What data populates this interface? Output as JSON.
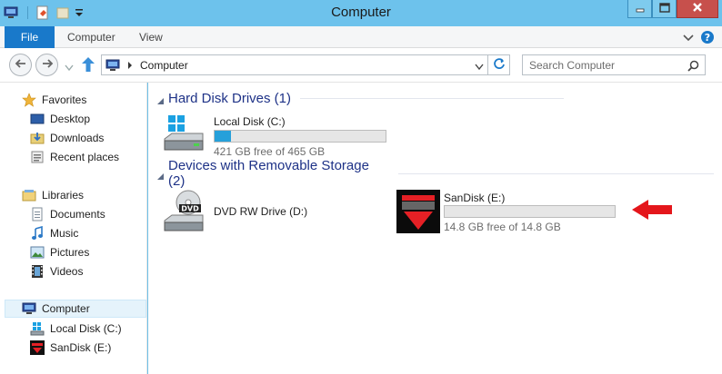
{
  "window": {
    "title": "Computer",
    "accent": "#6dc2ec"
  },
  "ribbon": {
    "tabs": [
      {
        "label": "File"
      },
      {
        "label": "Computer"
      },
      {
        "label": "View"
      }
    ]
  },
  "address": {
    "path": "Computer"
  },
  "search": {
    "placeholder": "Search Computer"
  },
  "sidebar": {
    "favorites": {
      "label": "Favorites",
      "items": [
        {
          "label": "Desktop"
        },
        {
          "label": "Downloads"
        },
        {
          "label": "Recent places"
        }
      ]
    },
    "libraries": {
      "label": "Libraries",
      "items": [
        {
          "label": "Documents"
        },
        {
          "label": "Music"
        },
        {
          "label": "Pictures"
        },
        {
          "label": "Videos"
        }
      ]
    },
    "computer": {
      "label": "Computer",
      "items": [
        {
          "label": "Local Disk (C:)"
        },
        {
          "label": "SanDisk (E:)"
        }
      ]
    }
  },
  "content": {
    "hard_disk_group": "Hard Disk Drives (1)",
    "removable_group": "Devices with Removable Storage (2)",
    "drives": {
      "local_disk": {
        "name": "Local Disk (C:)",
        "free": "421 GB free of 465 GB",
        "used_fraction": 0.095
      },
      "dvd": {
        "name": "DVD RW Drive (D:)",
        "icon_label": "DVD"
      },
      "sandisk": {
        "name": "SanDisk (E:)",
        "free": "14.8 GB free of 14.8 GB",
        "used_fraction": 0.0
      }
    }
  },
  "colors": {
    "storage_bar": "#26a0da",
    "annotation_arrow": "#e4161b",
    "file_tab": "#1979ca"
  }
}
